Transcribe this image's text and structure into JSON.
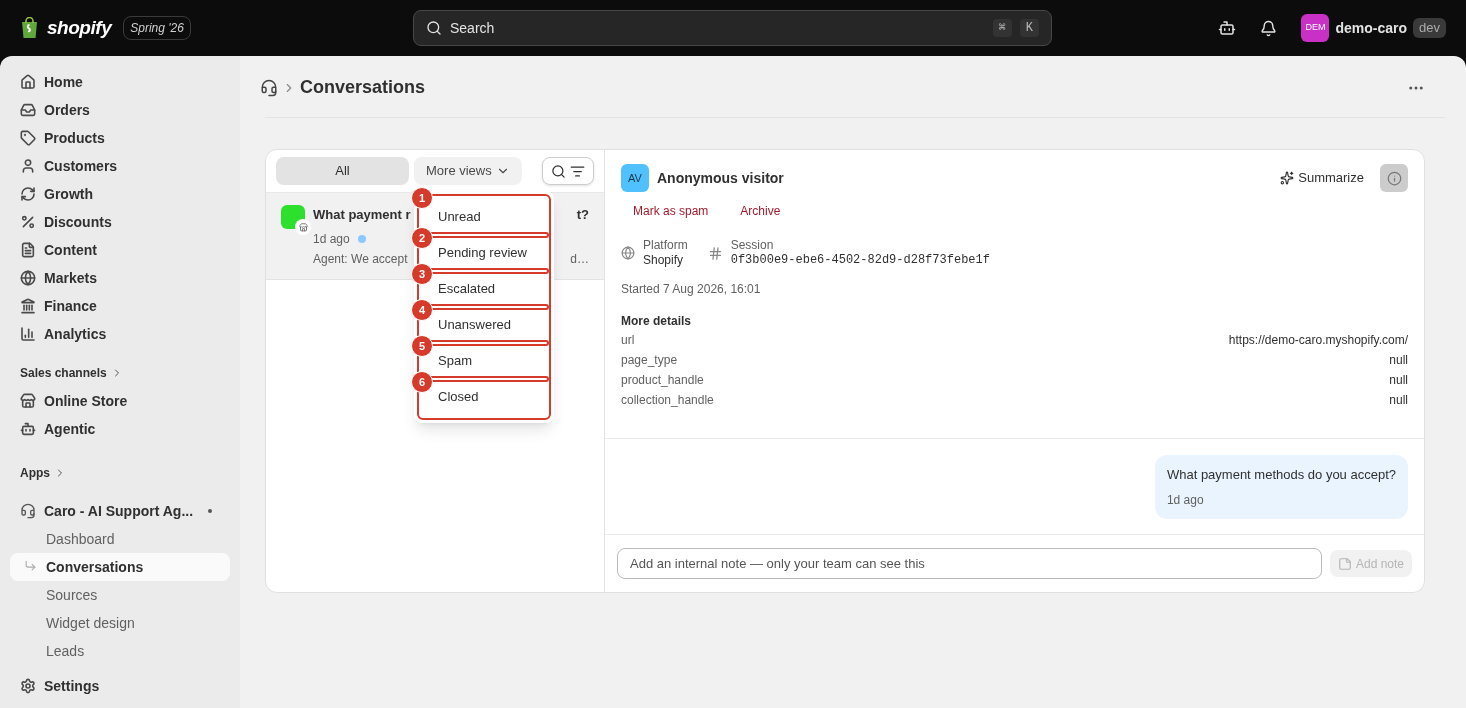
{
  "topbar": {
    "brand": "shopify",
    "release": "Spring '26",
    "search": {
      "placeholder": "Search",
      "shortcut": [
        "⌘",
        "K"
      ]
    },
    "store": {
      "initials": "DEM",
      "name": "demo-caro",
      "badge": "dev"
    }
  },
  "sidebar": {
    "items": [
      {
        "label": "Home"
      },
      {
        "label": "Orders"
      },
      {
        "label": "Products"
      },
      {
        "label": "Customers"
      },
      {
        "label": "Growth"
      },
      {
        "label": "Discounts"
      },
      {
        "label": "Content"
      },
      {
        "label": "Markets"
      },
      {
        "label": "Finance"
      },
      {
        "label": "Analytics"
      }
    ],
    "sales_channels": {
      "heading": "Sales channels",
      "items": [
        {
          "label": "Online Store"
        },
        {
          "label": "Agentic"
        }
      ]
    },
    "apps": {
      "heading": "Apps",
      "app": {
        "name": "Caro - AI Support Ag...",
        "pages": [
          {
            "label": "Dashboard",
            "selected": false
          },
          {
            "label": "Conversations",
            "selected": true
          },
          {
            "label": "Sources",
            "selected": false
          },
          {
            "label": "Widget design",
            "selected": false
          },
          {
            "label": "Leads",
            "selected": false
          }
        ]
      }
    },
    "settings": {
      "label": "Settings"
    }
  },
  "page": {
    "title": "Conversations"
  },
  "list": {
    "tabs": [
      {
        "label": "All",
        "selected": true
      },
      {
        "label": "More views",
        "selected": false
      }
    ],
    "conversation": {
      "title_parts": [
        "What payment r",
        "t?"
      ],
      "time": "1d ago",
      "unread": true,
      "preview_parts": [
        "Agent: We accept",
        "d…"
      ],
      "selected": true
    },
    "menu": {
      "items": [
        "Unread",
        "Pending review",
        "Escalated",
        "Unanswered",
        "Spam",
        "Closed"
      ]
    },
    "annotations": [
      {
        "number": "1",
        "kind": "outline"
      },
      {
        "number": "2",
        "kind": "separator"
      },
      {
        "number": "3",
        "kind": "separator"
      },
      {
        "number": "4",
        "kind": "separator"
      },
      {
        "number": "5",
        "kind": "separator"
      },
      {
        "number": "6",
        "kind": "separator"
      }
    ]
  },
  "detail": {
    "initials": "AV",
    "name": "Anonymous visitor",
    "summarize": "Summarize",
    "actions": [
      "Mark as spam",
      "Archive"
    ],
    "platform": {
      "label": "Platform",
      "value": "Shopify"
    },
    "session": {
      "label": "Session",
      "value": "0f3b00e9-ebe6-4502-82d9-d28f73febe1f"
    },
    "started": "Started 7 Aug 2026, 16:01",
    "more_details": {
      "title": "More details",
      "rows": [
        {
          "key": "url",
          "value": "https://demo-caro.myshopify.com/"
        },
        {
          "key": "page_type",
          "value": "null"
        },
        {
          "key": "product_handle",
          "value": "null"
        },
        {
          "key": "collection_handle",
          "value": "null"
        }
      ]
    },
    "messages": [
      {
        "text": "What payment methods do you accept?",
        "time": "1d ago"
      }
    ],
    "note": {
      "placeholder": "Add an internal note — only your team can see this",
      "button": "Add note",
      "disabled": true
    }
  }
}
